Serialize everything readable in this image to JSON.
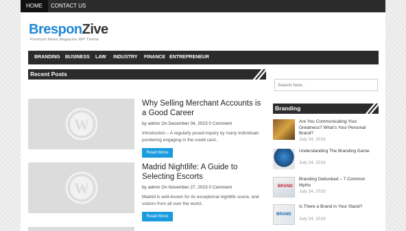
{
  "topnav": {
    "items": [
      {
        "label": "HOME"
      },
      {
        "label": "CONTACT US"
      }
    ]
  },
  "logo": {
    "part1": "Brespon",
    "part2": "Zive",
    "tagline": "Premium News Magazine WP Theme"
  },
  "catnav": {
    "items": [
      {
        "label": "BRANDING"
      },
      {
        "label": "BUSINESS"
      },
      {
        "label": "LAW"
      },
      {
        "label": "INDUSTRY"
      },
      {
        "label": "FINANCE"
      },
      {
        "label": "ENTREPRENEUR"
      }
    ]
  },
  "recent": {
    "heading": "Recent Posts",
    "posts": [
      {
        "title": "Why Selling Merchant Accounts is a Good Career",
        "meta": "by admin On December 04, 2023 0 Comment",
        "excerpt": "Introduction –    A regularly posed inquiry by many individuals pondering engaging in the credit card..",
        "read_more": "Read More"
      },
      {
        "title": "Madrid Nightlife: A Guide to Selecting Escorts",
        "meta": "by admin On November 27, 2023 0 Comment",
        "excerpt": "Madrid is well-known for its exceptional nightlife scene, and visitors from all over the world..",
        "read_more": "Read More"
      }
    ]
  },
  "sidebar": {
    "search_placeholder": "Search here..",
    "branding_heading": "Branding",
    "items": [
      {
        "title": "Are You Communicating Your Greatness? What's Your Personal Brand?",
        "date": "July 24, 2019"
      },
      {
        "title": "Understanding The Branding Game",
        "date": "July 24, 2019"
      },
      {
        "title": "Branding Debunked – 7 Common Myths",
        "date": "July 24, 2019"
      },
      {
        "title": "Is There a Brand in Your Stand?",
        "date": "July 24, 2019"
      }
    ]
  },
  "colors": {
    "dark_bar": "#2b2b2b",
    "accent_blue": "#1a9be0",
    "logo_blue": "#1e88d6"
  }
}
